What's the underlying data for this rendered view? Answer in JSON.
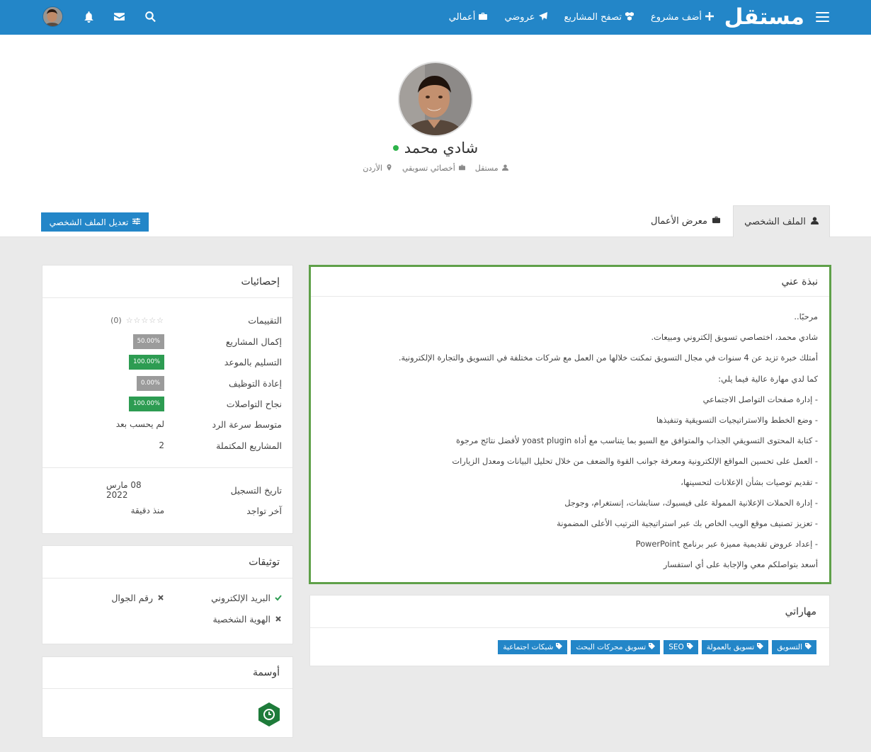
{
  "header": {
    "logo": "مستقل",
    "nav_links": [
      {
        "label": "أضف مشروع",
        "icon": "plus-icon"
      },
      {
        "label": "تصفح المشاريع",
        "icon": "cubes-icon"
      },
      {
        "label": "عروضي",
        "icon": "paper-plane-icon"
      },
      {
        "label": "أعمالي",
        "icon": "briefcase-icon"
      }
    ],
    "icons": [
      "search-icon",
      "envelope-icon",
      "bell-icon"
    ]
  },
  "profile": {
    "name": "شادي محمد",
    "online": true,
    "meta": [
      "مستقل",
      "أخصائي تسويقي",
      "الأردن"
    ]
  },
  "tabs": {
    "profile": "الملف الشخصي",
    "portfolio": "معرض الأعمال"
  },
  "edit_button": "تعديل الملف الشخصي",
  "about": {
    "title": "نبذة عني",
    "lines": [
      "مرحبًا..",
      "شادي محمد، اختصاصي تسويق إلكتروني ومبيعات.",
      "أمتلك خبرة تزيد عن 4 سنوات في مجال التسويق تمكنت خلالها من العمل مع شركات مختلفة في التسويق والتجارة الإلكترونية.",
      "كما لدي مهارة عالية فيما يلي:",
      "- إدارة صفحات التواصل الاجتماعي",
      "- وضع الخطط والاستراتيجيات التسويقية وتنفيذها",
      "- كتابة المحتوى التسويقي الجذاب والمتوافق مع السيو بما يتناسب مع أداة yoast plugin لأفضل نتائج مرجوة",
      "- العمل على تحسين المواقع الإلكترونية ومعرفة جوانب القوة والضعف من خلال تحليل البيانات ومعدل الزيارات",
      "- تقديم توصيات بشأن الإعلانات لتحسينها،",
      "- إدارة الحملات الإعلانية الممولة على فيسبوك، سنابشات، إنستغرام، وجوجل",
      "- تعزيز تصنيف موقع الويب الخاص بك عبر استراتيجية الترتيب الأعلى المضمونة",
      "- إعداد عروض تقديمية مميزة عبر برنامج PowerPoint",
      "أسعد بتواصلكم معي والإجابة على أي استفسار"
    ]
  },
  "skills": {
    "title": "مهاراتي",
    "items": [
      "التسويق",
      "تسويق بالعمولة",
      "SEO",
      "تسويق محركات البحث",
      "شبكات اجتماعية"
    ]
  },
  "stats": {
    "title": "إحصائيات",
    "rating_label": "التقييمات",
    "rating_count": "(0)",
    "rating_stars": 0,
    "completion_label": "إكمال المشاريع",
    "completion_value": "50.00%",
    "ontime_label": "التسليم بالموعد",
    "ontime_value": "100.00%",
    "rehire_label": "إعادة التوظيف",
    "rehire_value": "0.00%",
    "comm_label": "نجاح التواصلات",
    "comm_value": "100.00%",
    "response_label": "متوسط سرعة الرد",
    "response_value": "لم يحسب بعد",
    "done_label": "المشاريع المكتملة",
    "done_value": "2",
    "registered_label": "تاريخ التسجيل",
    "registered_value": "08 مارس 2022",
    "last_seen_label": "آخر تواجد",
    "last_seen_value": "منذ دقيقة"
  },
  "verifications": {
    "title": "توثيقات",
    "email": "البريد الإلكتروني",
    "phone": "رقم الجوال",
    "identity": "الهوية الشخصية",
    "colors": {
      "verified": "#2d9c52",
      "unverified": "#555555"
    }
  },
  "badges": {
    "title": "أوسمة",
    "items": [
      "clock-badge-icon"
    ],
    "color": "#1e7b3a"
  },
  "colors": {
    "primary": "#2386c8",
    "highlight_border": "#5fa049",
    "online": "#2db34a"
  }
}
